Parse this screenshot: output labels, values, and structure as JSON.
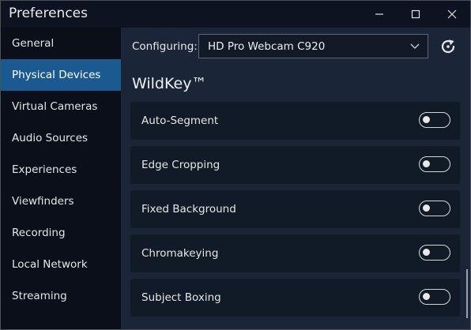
{
  "window": {
    "title": "Preferences"
  },
  "sidebar": {
    "items": [
      {
        "label": "General",
        "active": false
      },
      {
        "label": "Physical Devices",
        "active": true
      },
      {
        "label": "Virtual Cameras",
        "active": false
      },
      {
        "label": "Audio Sources",
        "active": false
      },
      {
        "label": "Experiences",
        "active": false
      },
      {
        "label": "Viewfinders",
        "active": false
      },
      {
        "label": "Recording",
        "active": false
      },
      {
        "label": "Local Network",
        "active": false
      },
      {
        "label": "Streaming",
        "active": false
      }
    ]
  },
  "config": {
    "label": "Configuring:",
    "device": "HD Pro Webcam C920"
  },
  "section": {
    "title": "WildKey™",
    "settings": [
      {
        "label": "Auto-Segment",
        "enabled": false
      },
      {
        "label": "Edge Cropping",
        "enabled": false
      },
      {
        "label": "Fixed Background",
        "enabled": false
      },
      {
        "label": "Chromakeying",
        "enabled": false
      },
      {
        "label": "Subject Boxing",
        "enabled": false
      }
    ]
  },
  "colors": {
    "accent": "#1a5a90",
    "sidebar_bg": "#0a0f19",
    "panel_bg": "#1a2637",
    "row_bg": "#111a27"
  },
  "icons": {
    "minimize": "minimize-icon",
    "maximize": "maximize-icon",
    "close": "close-icon",
    "dropdown": "chevron-down-icon",
    "refresh": "refresh-icon"
  }
}
